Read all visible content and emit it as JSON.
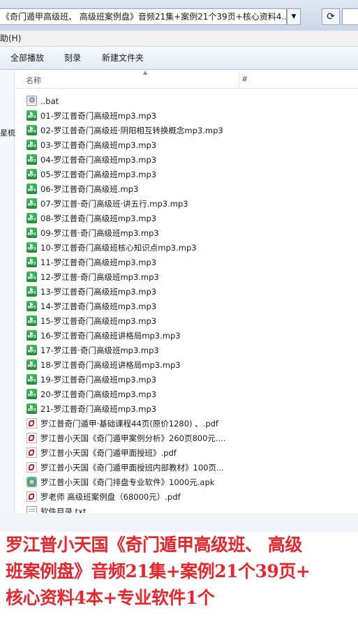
{
  "address_bar": {
    "path": "《奇门遁甲高级班、 高级班案例盘》音频21集+案例21个39页+核心资料4...",
    "dropdown_icon": "chevron-down-icon",
    "refresh_icon": "refresh-icon",
    "search_icon": "search-icon"
  },
  "menu": {
    "help": "助(H)"
  },
  "toolbar": {
    "play_all": "全部播放",
    "burn": "刻录",
    "new_folder": "新建文件夹"
  },
  "nav_pane": {
    "truncated": "星梳"
  },
  "columns": {
    "name": "名称",
    "number": "#"
  },
  "files": [
    {
      "name": "..bat",
      "icon": "bat-file-icon"
    },
    {
      "name": "01-罗江普奇门高级班mp3.mp3",
      "icon": "mp3-file-icon"
    },
    {
      "name": "02-罗江普奇门高级班·阴阳相互转换概念mp3.mp3",
      "icon": "mp3-file-icon"
    },
    {
      "name": "03-罗江普奇门高级班mp3.mp3",
      "icon": "mp3-file-icon"
    },
    {
      "name": "04-罗江普奇门高级班mp3.mp3",
      "icon": "mp3-file-icon"
    },
    {
      "name": "05-罗江普奇门高级班mp3.mp3",
      "icon": "mp3-file-icon"
    },
    {
      "name": "06-罗江普奇门高级班.mp3",
      "icon": "mp3-file-icon"
    },
    {
      "name": "07-罗江普·奇门高级班·讲五行.mp3.mp3",
      "icon": "mp3-file-icon"
    },
    {
      "name": "08-罗江普奇门高级班mp3.mp3",
      "icon": "mp3-file-icon"
    },
    {
      "name": "09-罗江普·奇门高级班mp3.mp3",
      "icon": "mp3-file-icon"
    },
    {
      "name": "10-罗江普奇门高级班核心知识点mp3.mp3",
      "icon": "mp3-file-icon"
    },
    {
      "name": "11-罗江普奇门高级班mp3.mp3",
      "icon": "mp3-file-icon"
    },
    {
      "name": "12-罗江普·奇门高级班mp3.mp3",
      "icon": "mp3-file-icon"
    },
    {
      "name": "13-罗江普奇门高级班mp3.mp3",
      "icon": "mp3-file-icon"
    },
    {
      "name": "14-罗江普奇门高级班mp3.mp3",
      "icon": "mp3-file-icon"
    },
    {
      "name": "15-罗江普奇门高级班mp3.mp3",
      "icon": "mp3-file-icon"
    },
    {
      "name": "16-罗江普奇门高级班讲格局mp3.mp3",
      "icon": "mp3-file-icon"
    },
    {
      "name": "17-罗江普·奇门高级班mp3.mp3",
      "icon": "mp3-file-icon"
    },
    {
      "name": "18-罗江普奇门高级班讲格局mp3.mp3",
      "icon": "mp3-file-icon"
    },
    {
      "name": "19-罗江普奇门高级班mp3.mp3",
      "icon": "mp3-file-icon"
    },
    {
      "name": "20-罗江普奇门高级班mp3.mp3",
      "icon": "mp3-file-icon"
    },
    {
      "name": "21-罗江普奇门高级班mp3.mp3",
      "icon": "mp3-file-icon"
    },
    {
      "name": "罗江普奇门遁甲·基础课程44页(原价1280) 、.pdf",
      "icon": "pdf-file-icon"
    },
    {
      "name": "罗江普小天国《奇门遁甲案例分析》260页800元....",
      "icon": "pdf-file-icon"
    },
    {
      "name": "罗江普小天国《奇门遁甲面授班》.pdf",
      "icon": "pdf-file-icon"
    },
    {
      "name": "罗江普小天国《奇门遁甲面授班内部教材》100页...",
      "icon": "pdf-file-icon"
    },
    {
      "name": "罗江普小天国《奇门排盘专业软件》1000元.apk",
      "icon": "apk-file-icon"
    },
    {
      "name": "罗老师 高级班案例盘（68000元）.pdf",
      "icon": "pdf-file-icon"
    },
    {
      "name": "软件目录.txt",
      "icon": "txt-file-icon"
    }
  ],
  "caption": {
    "line1": "罗江普小天国《奇门遁甲高级班、 高级",
    "line2": "班案例盘》音频21集+案例21个39页+",
    "line3": "核心资料4本+专业软件1个",
    "color": "#e8262b"
  }
}
